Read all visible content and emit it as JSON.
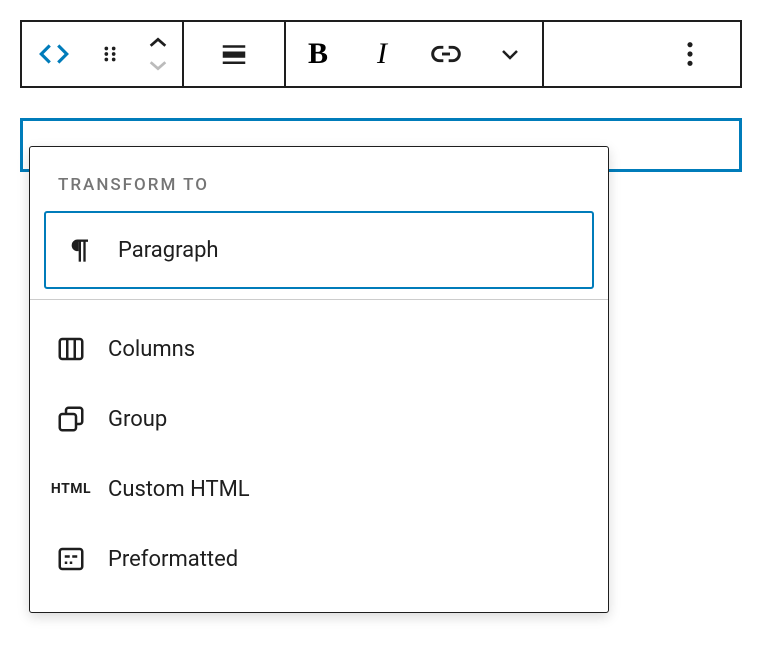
{
  "toolbar": {
    "block_type": "Custom HTML",
    "move_up": "Move up",
    "move_down": "Move down",
    "align": "Align",
    "bold": "Bold",
    "italic": "Italic",
    "link": "Link",
    "more_formatting": "More formatting",
    "more_options": "More options"
  },
  "popover": {
    "label": "TRANSFORM TO",
    "items": [
      {
        "label": "Paragraph",
        "icon": "paragraph"
      },
      {
        "label": "Columns",
        "icon": "columns"
      },
      {
        "label": "Group",
        "icon": "group"
      },
      {
        "label": "Custom HTML",
        "icon": "html"
      },
      {
        "label": "Preformatted",
        "icon": "preformatted"
      }
    ]
  },
  "colors": {
    "accent": "#007cba",
    "border": "#1e1e1e",
    "muted": "#757575"
  }
}
